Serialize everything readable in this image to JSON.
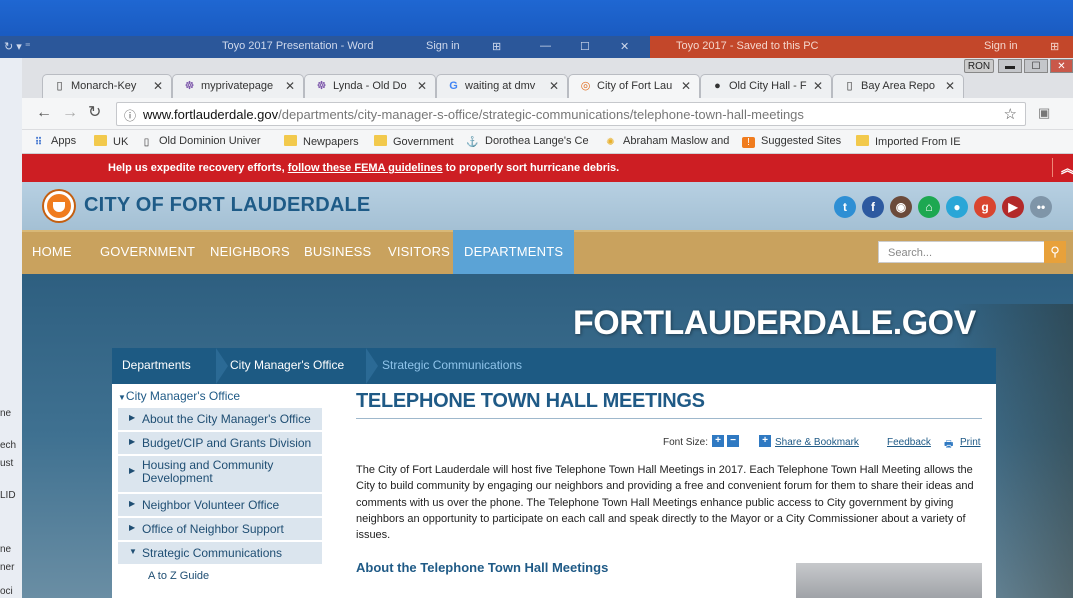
{
  "desktop": {
    "word_title": "Toyo 2017 Presentation - Word",
    "word_signin": "Sign in",
    "ppt_title": "Toyo 2017 - Saved to this PC",
    "ppt_signin": "Sign in",
    "side_fragments": [
      "ne",
      "ech",
      "ust",
      "LID",
      "ne",
      "ner",
      "oci"
    ]
  },
  "browser": {
    "profile": "RON",
    "tabs": [
      {
        "label": "Monarch-Key",
        "icon": "document-icon",
        "active": false
      },
      {
        "label": "myprivatepage",
        "icon": "myprivatepage-icon",
        "active": false
      },
      {
        "label": "Lynda - Old Do",
        "icon": "lynda-icon",
        "active": false
      },
      {
        "label": "waiting at dmv",
        "icon": "google-icon",
        "active": false
      },
      {
        "label": "City of Fort Lau",
        "icon": "city-logo-icon",
        "active": true
      },
      {
        "label": "Old City Hall - F",
        "icon": "globe-icon",
        "active": false
      },
      {
        "label": "Bay Area Repo",
        "icon": "document-icon",
        "active": false
      }
    ],
    "url_host": "www.fortlauderdale.gov",
    "url_path": "/departments/city-manager-s-office/strategic-communications/telephone-town-hall-meetings",
    "bookmarks": [
      "Apps",
      "UK",
      "Old Dominion Univer",
      "Newpapers",
      "Government",
      "Dorothea Lange's Ce",
      "Abraham Maslow and",
      "Suggested Sites",
      "Imported From IE"
    ]
  },
  "site": {
    "alert_pre": "Help us expedite recovery efforts, ",
    "alert_link": "follow these FEMA guidelines",
    "alert_post": " to properly sort hurricane debris.",
    "city_name": "CITY OF FORT LAUDERDALE",
    "social": [
      "twitter-icon",
      "facebook-icon",
      "instagram-icon",
      "nextdoor-icon",
      "periscope-icon",
      "google-plus-icon",
      "youtube-icon",
      "flickr-icon"
    ],
    "nav": [
      "HOME",
      "GOVERNMENT",
      "NEIGHBORS",
      "BUSINESS",
      "VISITORS",
      "DEPARTMENTS"
    ],
    "search_placeholder": "Search...",
    "hero_title": "FORTLAUDERDALE.GOV",
    "breadcrumb": [
      "Departments",
      "City Manager's Office",
      "Strategic Communications"
    ],
    "sidebar": {
      "heading": "City Manager's Office",
      "items": [
        "About the City Manager's Office",
        "Budget/CIP and Grants Division",
        "Housing and Community",
        "Development",
        "Neighbor Volunteer Office",
        "Office of Neighbor Support",
        "Strategic Communications",
        "A to Z Guide"
      ]
    },
    "page_title": "TELEPHONE TOWN HALL MEETINGS",
    "font_size_label": "Font Size:",
    "share_label": "Share & Bookmark",
    "feedback_label": "Feedback",
    "print_label": "Print",
    "intro": "The City of Fort Lauderdale will host five Telephone Town Hall Meetings in 2017.  Each Telephone Town Hall Meeting allows the City to build community by engaging our neighbors and providing a free and convenient forum for them to share their ideas and comments with us over the phone. The Telephone Town Hall Meetings enhance public access to City government by giving neighbors an opportunity to participate on each call and speak directly to the Mayor or a City Commissioner about a variety of issues.",
    "section_heading": "About the Telephone Town Hall Meetings"
  }
}
